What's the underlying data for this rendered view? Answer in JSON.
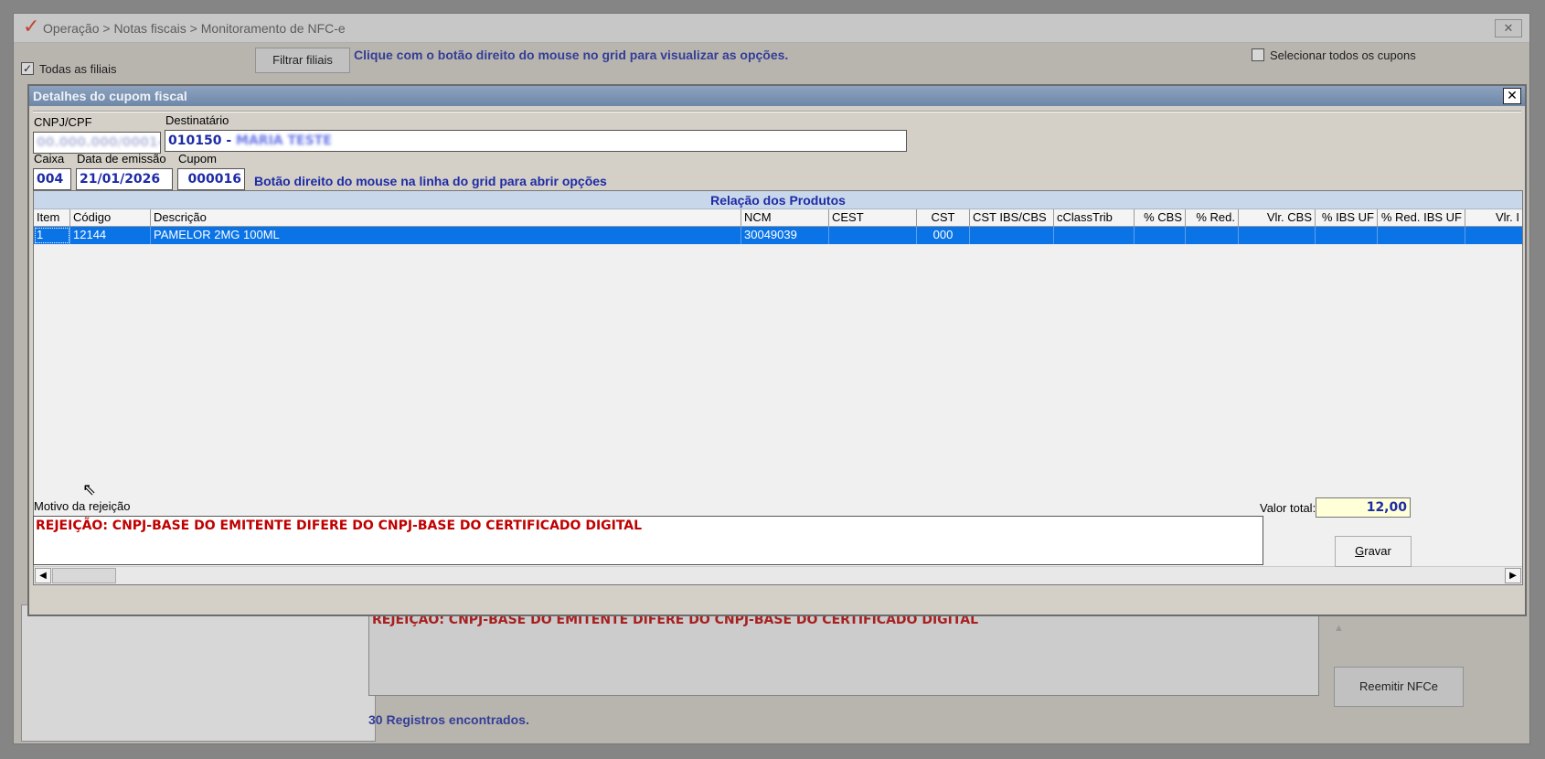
{
  "main_window": {
    "title": "Operação > Notas fiscais > Monitoramento de NFC-e",
    "close_label": "✕",
    "all_branches_label": "Todas as filiais",
    "all_branches_checked": true,
    "filter_branches_button": "Filtrar filiais",
    "grid_hint": "Clique com o botão direito do mouse no grid para visualizar as opções.",
    "select_all_coupons_label": "Selecionar todos os cupons",
    "select_all_coupons_checked": false,
    "rejection_text": "REJEIÇÃO: CNPJ-BASE DO EMITENTE DIFERE DO CNPJ-BASE DO CERTIFICADO DIGITAL",
    "reissue_button": "Reemitir NFCe",
    "records_found": "30 Registros encontrados."
  },
  "dialog": {
    "title": "Detalhes do cupom fiscal",
    "close_label": "✕",
    "cnpj_label": "CNPJ/CPF",
    "cnpj_value": "00.000.000/0001-00",
    "recipient_label": "Destinatário",
    "recipient_code": "010150 - ",
    "recipient_name": "MARIA TESTE",
    "caixa_label": "Caixa",
    "caixa_value": "004",
    "issue_date_label": "Data de emissão",
    "issue_date_value": "21/01/2026",
    "cupom_label": "Cupom",
    "cupom_value": "000016",
    "grid_hint": "Botão direito do mouse na linha do grid para abrir opções",
    "products": {
      "caption": "Relação dos Produtos",
      "columns": [
        "Item",
        "Código",
        "Descrição",
        "NCM",
        "CEST",
        "CST",
        "CST IBS/CBS",
        "cClassTrib",
        "% CBS",
        "% Red.",
        "Vlr. CBS",
        "% IBS UF",
        "% Red. IBS UF",
        "Vlr. I"
      ],
      "rows": [
        [
          "1",
          "12144",
          "PAMELOR  2MG 100ML",
          "30049039",
          "",
          "000",
          "",
          "",
          "",
          "",
          "",
          "",
          "",
          ""
        ]
      ]
    },
    "rejection_label": "Motivo da rejeição",
    "rejection_text": "REJEIÇÃO: CNPJ-BASE DO EMITENTE DIFERE DO CNPJ-BASE DO CERTIFICADO DIGITAL",
    "total_label": "Valor total:",
    "total_value": "12,00",
    "save_button_prefix": "G",
    "save_button_rest": "ravar"
  }
}
